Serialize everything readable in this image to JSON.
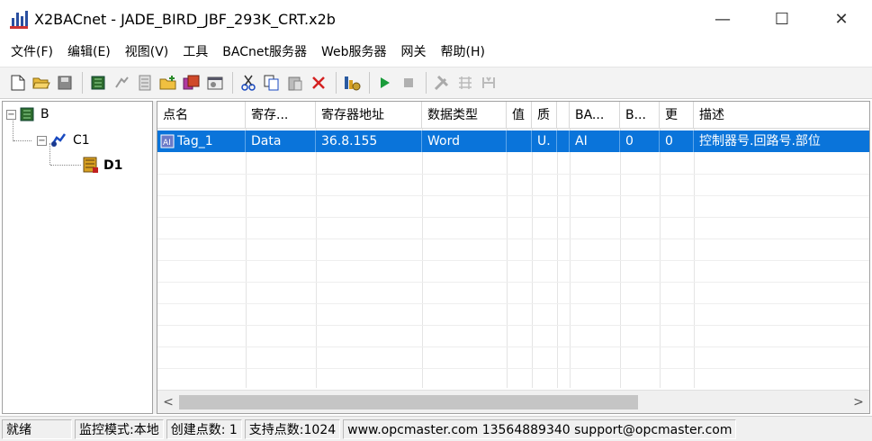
{
  "window": {
    "title": "X2BACnet - JADE_BIRD_JBF_293K_CRT.x2b",
    "min_glyph": "—",
    "max_glyph": "☐",
    "close_glyph": "✕"
  },
  "menu": [
    "文件(F)",
    "编辑(E)",
    "视图(V)",
    "工具",
    "BACnet服务器",
    "Web服务器",
    "网关",
    "帮助(H)"
  ],
  "toolbar": {
    "groups": [
      [
        "new-file-icon",
        "open-folder-icon",
        "save-icon"
      ],
      [
        "add-device-icon",
        "add-tag-icon",
        "device-list-icon",
        "add-folder-icon",
        "import-icon",
        "properties-icon"
      ],
      [
        "cut-icon",
        "copy-icon",
        "paste-icon",
        "delete-icon"
      ],
      [
        "monitor-icon"
      ],
      [
        "run-icon",
        "stop-icon"
      ],
      [
        "tools-icon",
        "scan-icon",
        "scan-all-icon"
      ]
    ]
  },
  "tree": {
    "root": "B",
    "channel": "C1",
    "device": "D1"
  },
  "table": {
    "headers": [
      "点名",
      "寄存...",
      "寄存器地址",
      "数据类型",
      "值",
      "质",
      "",
      "BA...",
      "B...",
      "更",
      "描述"
    ],
    "rows": [
      [
        "Tag_1",
        "Data",
        "36.8.155",
        "Word",
        "",
        "U.",
        "",
        "AI",
        "0",
        "0",
        "控制器号.回路号.部位"
      ]
    ]
  },
  "scrollbar": {
    "left_arrow": "<",
    "right_arrow": ">"
  },
  "status": {
    "ready": "就绪",
    "mode": "监控模式:本地",
    "created": "创建点数: 1",
    "supported": "支持点数:1024",
    "contact": "www.opcmaster.com 13564889340 support@opcmaster.com"
  },
  "colors": {
    "selection": "#0a74da",
    "run": "#1a9c3a",
    "delete": "#d42020"
  }
}
